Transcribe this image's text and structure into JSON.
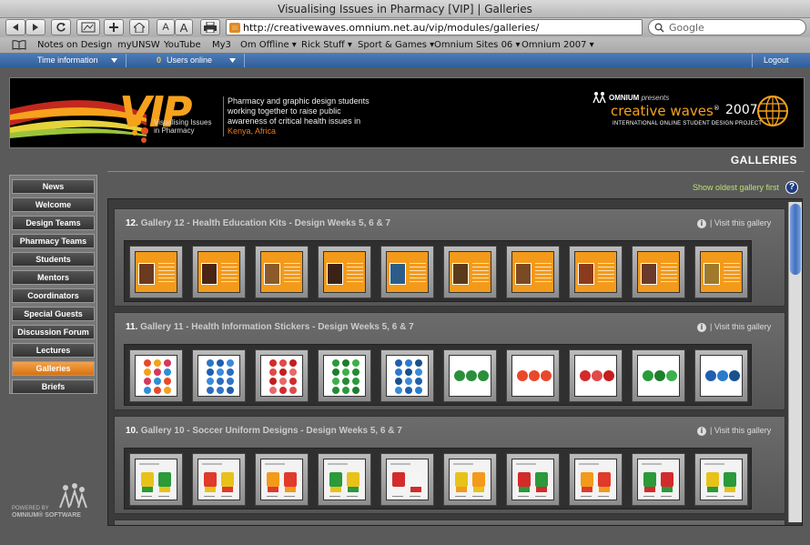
{
  "window": {
    "title": "Visualising Issues in Pharmacy [VIP] | Galleries"
  },
  "toolbar": {
    "font_small_label": "A",
    "font_large_label": "A",
    "url": "http://creativewaves.omnium.net.au/vip/modules/galleries/",
    "search_placeholder": "Google"
  },
  "bookmarks": [
    "Notes on Design",
    "myUNSW",
    "YouTube",
    "My3",
    "Om Offline ▾",
    "Rick Stuff ▾",
    "Sport & Games ▾",
    "Omnium Sites 06 ▾",
    "Omnium 2007 ▾"
  ],
  "topbar": {
    "time_info": "Time information",
    "users_count": "0",
    "users_label": "Users online",
    "logout": "Logout"
  },
  "banner": {
    "logo": "VIP",
    "logo_sub_1": "Visualising Issues",
    "logo_sub_2": "in Pharmacy",
    "description": "Pharmacy and graphic design students working together to raise public awareness of critical health issues in",
    "location": "Kenya, Africa",
    "omnium": "OMNIUM",
    "presents": "presents",
    "cw_title": "creative waves",
    "cw_reg": "®",
    "cw_year": "2007",
    "cw_sub": "INTERNATIONAL ONLINE STUDENT DESIGN PROJECT"
  },
  "nav": [
    {
      "label": "News",
      "active": false
    },
    {
      "label": "Welcome",
      "active": false
    },
    {
      "label": "Design Teams",
      "active": false
    },
    {
      "label": "Pharmacy Teams",
      "active": false
    },
    {
      "label": "Students",
      "active": false
    },
    {
      "label": "Mentors",
      "active": false
    },
    {
      "label": "Coordinators",
      "active": false
    },
    {
      "label": "Special Guests",
      "active": false
    },
    {
      "label": "Discussion Forum",
      "active": false
    },
    {
      "label": "Lectures",
      "active": false
    },
    {
      "label": "Galleries",
      "active": true
    },
    {
      "label": "Briefs",
      "active": false
    }
  ],
  "powered": {
    "line1": "POWERED BY",
    "line2": "OMNIUM® SOFTWARE"
  },
  "main": {
    "title": "GALLERIES",
    "sort_link": "Show oldest gallery first",
    "help": "?"
  },
  "galleries": [
    {
      "number": "12.",
      "title": "Gallery 12 - Health Education Kits - Design Weeks 5, 6 & 7",
      "visit": "Visit this gallery",
      "kind": "kit"
    },
    {
      "number": "11.",
      "title": "Gallery 11 - Health Information Stickers - Design Weeks 5, 6 & 7",
      "visit": "Visit this gallery",
      "kind": "sticker"
    },
    {
      "number": "10.",
      "title": "Gallery 10 - Soccer Uniform Designs - Design Weeks 5, 6 & 7",
      "visit": "Visit this gallery",
      "kind": "uniform"
    }
  ],
  "colors": {
    "accent_orange": "#f6a21d",
    "nav_active": "#e8841f",
    "link_green": "#b7e36a",
    "topbar_blue": "#3a6aa8"
  },
  "icons": [
    "back-icon",
    "forward-icon",
    "reload-icon",
    "add-bookmark-icon",
    "home-icon",
    "print-icon",
    "bookmarks-book-icon",
    "search-icon",
    "info-icon",
    "help-icon",
    "omnium-figures-icon",
    "globe-icon"
  ]
}
